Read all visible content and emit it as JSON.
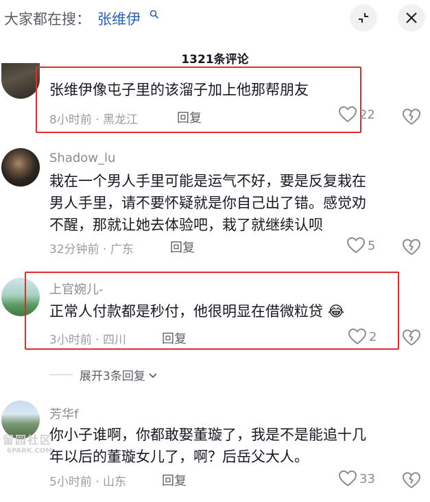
{
  "header": {
    "search_prefix": "大家都在搜：",
    "search_term": "张维伊",
    "search_icon": "search-icon",
    "collapse_icon": "collapse-icon",
    "close_icon": "close-icon"
  },
  "comment_count": "1321条评论",
  "comments": [
    {
      "content": "张维伊像屯子里的该溜子加上他那帮朋友",
      "meta": "8小时前 · 黑龙江",
      "reply": "回复",
      "likes": "22"
    },
    {
      "username": "Shadow_lu",
      "content_lines": [
        "栽在一个男人手里可能是运气不好，要是反复栽在",
        "男人手里，请不要怀疑就是你自己出了错。感觉劝",
        "不醒，那就让她去体验吧，栽了就继续认呗"
      ],
      "meta": "32分钟前 · 广东",
      "reply": "回复",
      "likes": "5"
    },
    {
      "username": "上官婉儿-",
      "content": "正常人付款都是秒付，他很明显在借微粒贷",
      "emoji": "😂",
      "meta": "3小时前 · 四川",
      "reply": "回复",
      "likes": "2"
    },
    {
      "username": "芳华f",
      "content_lines": [
        "你小子谁啊，你都敢娶董璇了，我是不是能追十几",
        "年以后的董璇女儿了，啊？后岳父大人。"
      ],
      "meta": "5小时前 · 山东",
      "reply": "回复",
      "likes": "33"
    }
  ],
  "expand_replies": "展开3条回复",
  "watermark": {
    "text": "留园社区",
    "sub": "6PARK.COM"
  },
  "colors": {
    "highlight": "#e52a2a",
    "search_term": "#2a60b8"
  }
}
